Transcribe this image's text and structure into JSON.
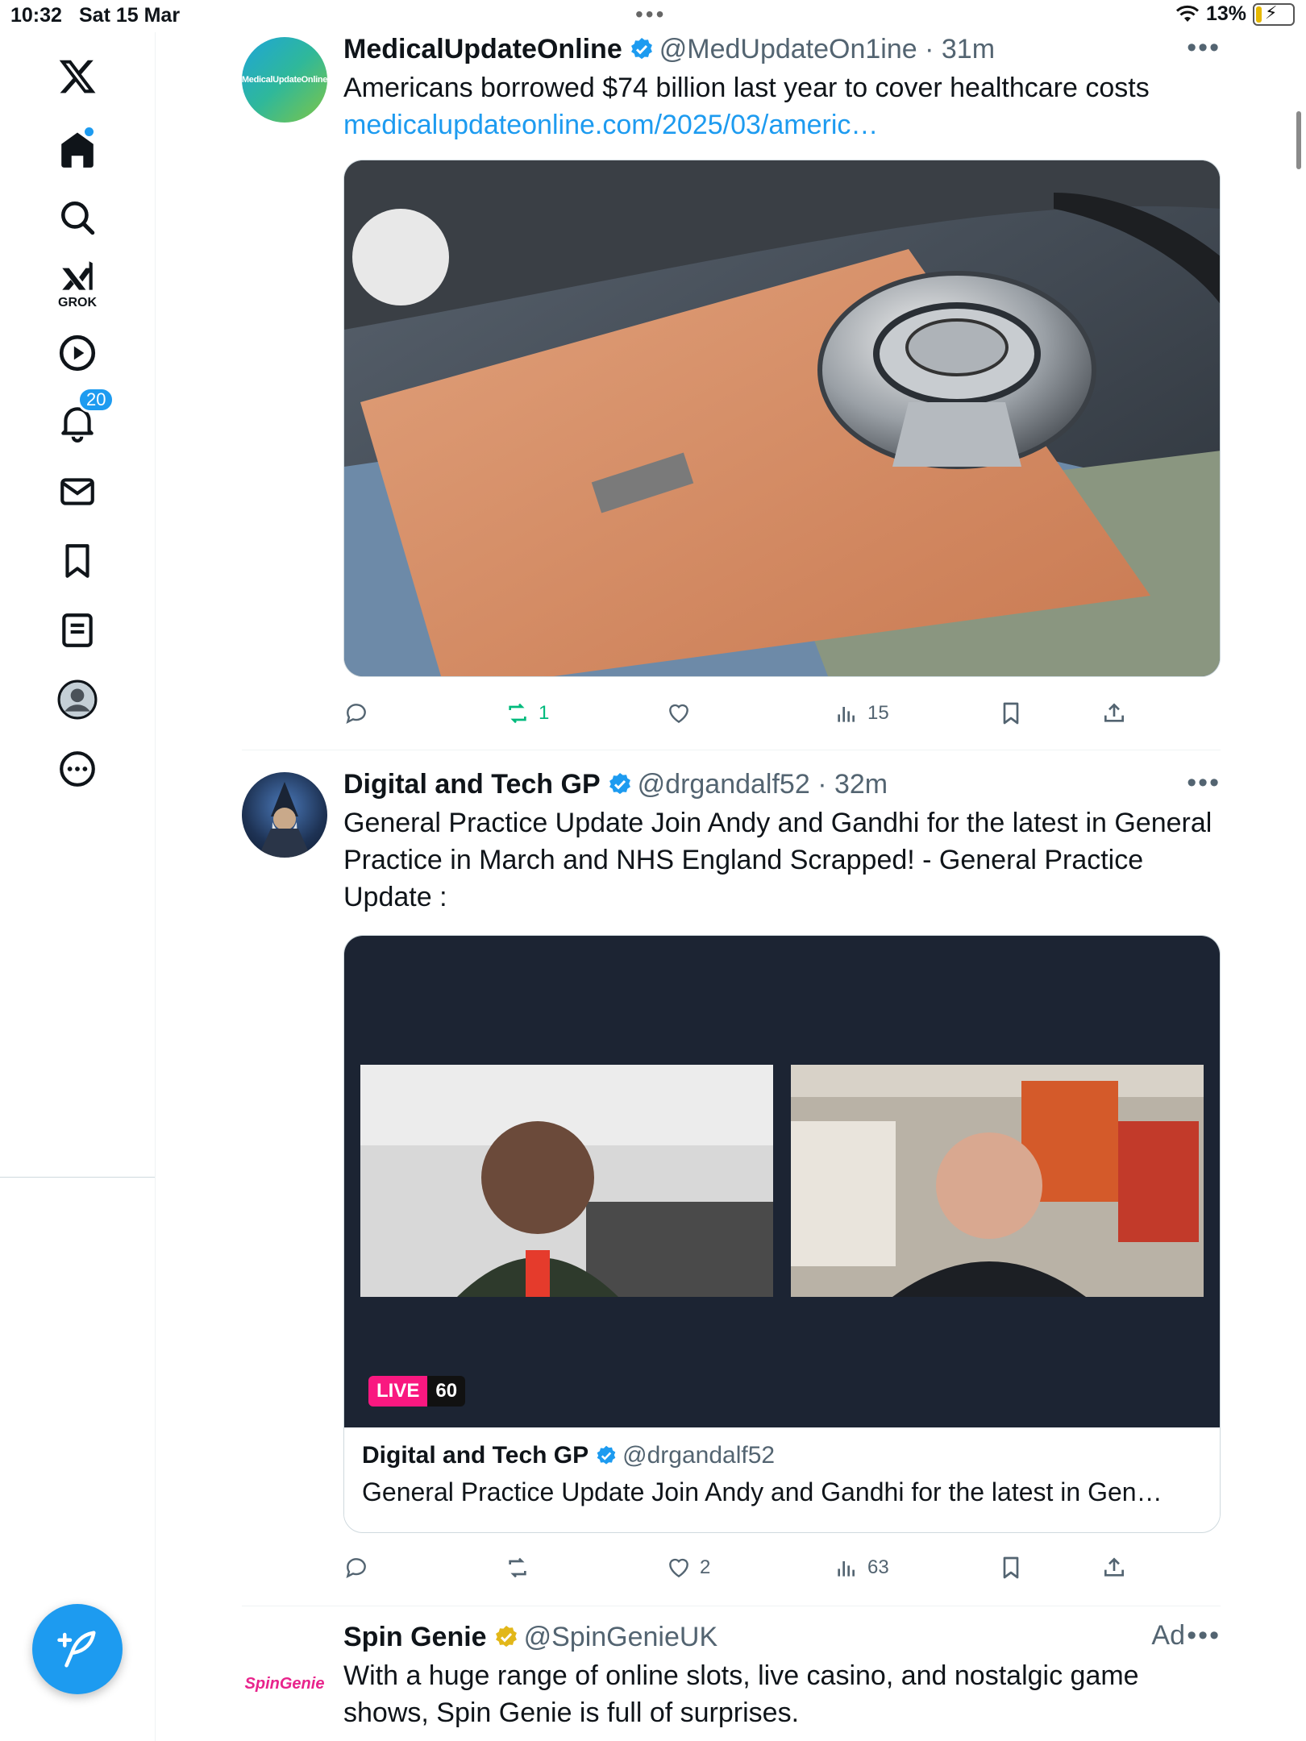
{
  "status_bar": {
    "time": "10:32",
    "date": "Sat 15 Mar",
    "battery": "13%"
  },
  "sidebar": {
    "items": [
      {
        "name": "home"
      },
      {
        "name": "explore"
      },
      {
        "name": "grok",
        "label": "GROK"
      },
      {
        "name": "video"
      },
      {
        "name": "notifications",
        "badge": "20"
      },
      {
        "name": "messages"
      },
      {
        "name": "bookmarks"
      },
      {
        "name": "lists"
      },
      {
        "name": "profile"
      },
      {
        "name": "more"
      }
    ]
  },
  "tweets": [
    {
      "name": "MedicalUpdateOnline",
      "handle": "@MedUpdateOn1ine",
      "time": "31m",
      "avatar_text": "MedicalUpdateOnline",
      "text": "Americans borrowed $74 billion last year to cover healthcare costs",
      "link": "medicalupdateonline.com/2025/03/americ…",
      "stats": {
        "replies": "",
        "retweets": "1",
        "likes": "",
        "views": "15"
      }
    },
    {
      "name": "Digital and Tech GP",
      "handle": "@drgandalf52",
      "time": "32m",
      "text": "General Practice Update Join Andy and Gandhi for the latest in General Practice in March and NHS England Scrapped! - General Practice Update :",
      "live": {
        "label": "LIVE",
        "count": "60"
      },
      "card": {
        "name": "Digital and Tech GP",
        "handle": "@drgandalf52",
        "text": "General Practice Update Join Andy and Gandhi for the latest in Gen…"
      },
      "stats": {
        "replies": "",
        "retweets": "",
        "likes": "2",
        "views": "63"
      }
    },
    {
      "name": "Spin Genie",
      "handle": "@SpinGenieUK",
      "ad_label": "Ad",
      "avatar_text": "SpinGenie",
      "text": "With a huge range of online slots, live casino, and nostalgic game shows, Spin Genie is full of surprises."
    }
  ],
  "colors": {
    "accent": "#1d9bf0",
    "retweet_active": "#00ba7c",
    "live": "#f91880",
    "gold_verified": "#e2b719"
  }
}
